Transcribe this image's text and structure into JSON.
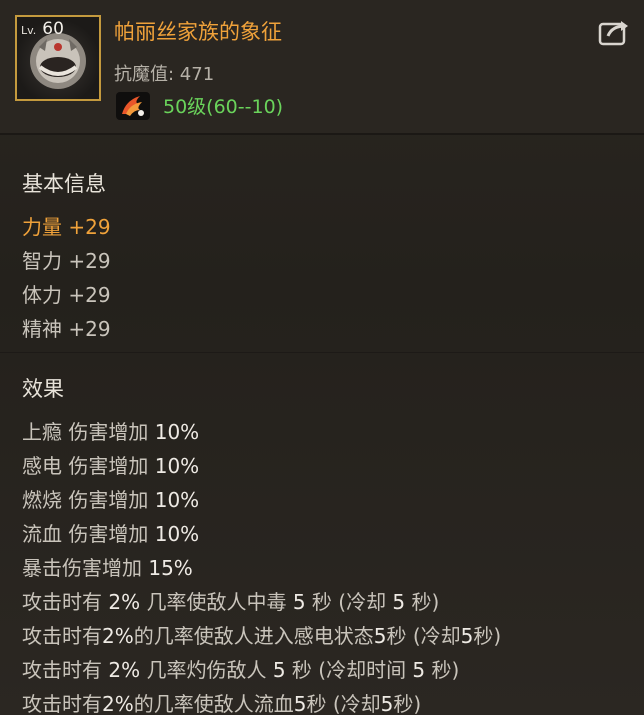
{
  "item": {
    "level_prefix": "Lv.",
    "level": "60",
    "name": "帕丽丝家族的象征",
    "stat": "抗魔值: 471",
    "grade": "50级(60--10)"
  },
  "basic": {
    "title": "基本信息",
    "rows": [
      {
        "label": "力量",
        "value": "+29"
      },
      {
        "label": "智力",
        "value": "+29"
      },
      {
        "label": "体力",
        "value": "+29"
      },
      {
        "label": "精神",
        "value": "+29"
      }
    ]
  },
  "effects": {
    "title": "效果",
    "rows": [
      {
        "a": "上瘾 伤害增加 ",
        "b": "10%",
        "c": "",
        "d": "",
        "e": "",
        "f": "",
        "g": "",
        "h": ""
      },
      {
        "a": "感电 伤害增加 ",
        "b": "10%",
        "c": "",
        "d": "",
        "e": "",
        "f": "",
        "g": "",
        "h": ""
      },
      {
        "a": "燃烧 伤害增加 ",
        "b": "10%",
        "c": "",
        "d": "",
        "e": "",
        "f": "",
        "g": "",
        "h": ""
      },
      {
        "a": "流血 伤害增加 ",
        "b": "10%",
        "c": "",
        "d": "",
        "e": "",
        "f": "",
        "g": "",
        "h": ""
      },
      {
        "a": "暴击伤害增加 ",
        "b": "15%",
        "c": "",
        "d": "",
        "e": "",
        "f": "",
        "g": "",
        "h": ""
      },
      {
        "a": "攻击时有 ",
        "b": "2%",
        "c": " 几率使敌人中毒 ",
        "d": "5",
        "e": " 秒 (冷却 ",
        "f": "5",
        "g": " 秒)",
        "h": ""
      },
      {
        "a": "攻击时有",
        "b": "2%",
        "c": "的几率使敌人进入感电状态",
        "d": "5",
        "e": "秒 (冷却",
        "f": "5",
        "g": "秒)",
        "h": ""
      },
      {
        "a": "攻击时有 ",
        "b": "2%",
        "c": " 几率灼伤敌人 ",
        "d": "5",
        "e": " 秒 (冷却时间 ",
        "f": "5",
        "g": " 秒)",
        "h": ""
      },
      {
        "a": "攻击时有",
        "b": "2%",
        "c": "的几率使敌人流血",
        "d": "5",
        "e": "秒 (冷却",
        "f": "5",
        "g": "秒)",
        "h": ""
      }
    ]
  },
  "colors": {
    "name": "#f0a23a",
    "grade": "#6ad35b",
    "frame": "#c49a3e"
  },
  "icons": {
    "item": "round-helmet-icon",
    "grade": "flame-bird-icon",
    "share": "share-arrow-icon"
  }
}
